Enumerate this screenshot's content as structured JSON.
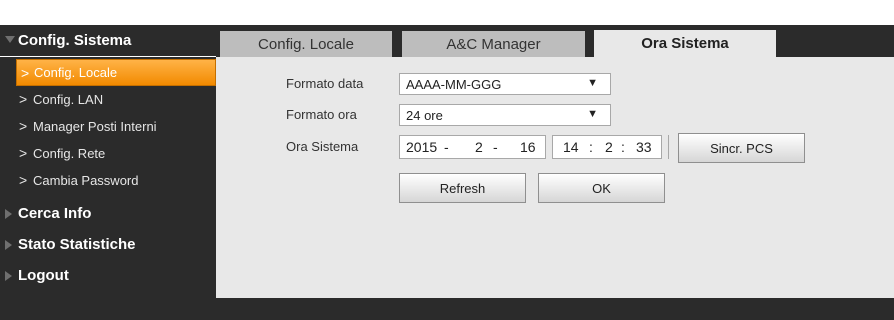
{
  "sidebar": {
    "sections": [
      {
        "label": "Config. Sistema",
        "expanded": true
      },
      {
        "label": "Cerca Info",
        "expanded": false
      },
      {
        "label": "Stato Statistiche",
        "expanded": false
      },
      {
        "label": "Logout",
        "expanded": false
      }
    ],
    "items": [
      {
        "label": "Config. Locale",
        "active": true
      },
      {
        "label": "Config. LAN",
        "active": false
      },
      {
        "label": "Manager Posti Interni",
        "active": false
      },
      {
        "label": "Config. Rete",
        "active": false
      },
      {
        "label": "Cambia Password",
        "active": false
      }
    ],
    "chevron": ">"
  },
  "tabs": [
    {
      "label": "Config. Locale",
      "active": false
    },
    {
      "label": "A&C Manager",
      "active": false
    },
    {
      "label": "Ora Sistema",
      "active": true
    }
  ],
  "form": {
    "date_format_label": "Formato data",
    "date_format_value": "AAAA-MM-GGG",
    "time_format_label": "Formato ora",
    "time_format_value": "24 ore",
    "system_time_label": "Ora Sistema",
    "date": {
      "year": "2015",
      "month": "2",
      "day": "16",
      "sep": "-"
    },
    "time": {
      "hour": "14",
      "minute": "2",
      "second": "33",
      "sep": ":"
    },
    "sync_button": "Sincr. PCS",
    "refresh_button": "Refresh",
    "ok_button": "OK",
    "dropdown_arrow": "▼"
  },
  "colors": {
    "accent": "#f28a00",
    "sidebar_bg": "#2b2b2b",
    "content_bg": "#e8e8e8",
    "tab_inactive": "#bdbdbd"
  }
}
